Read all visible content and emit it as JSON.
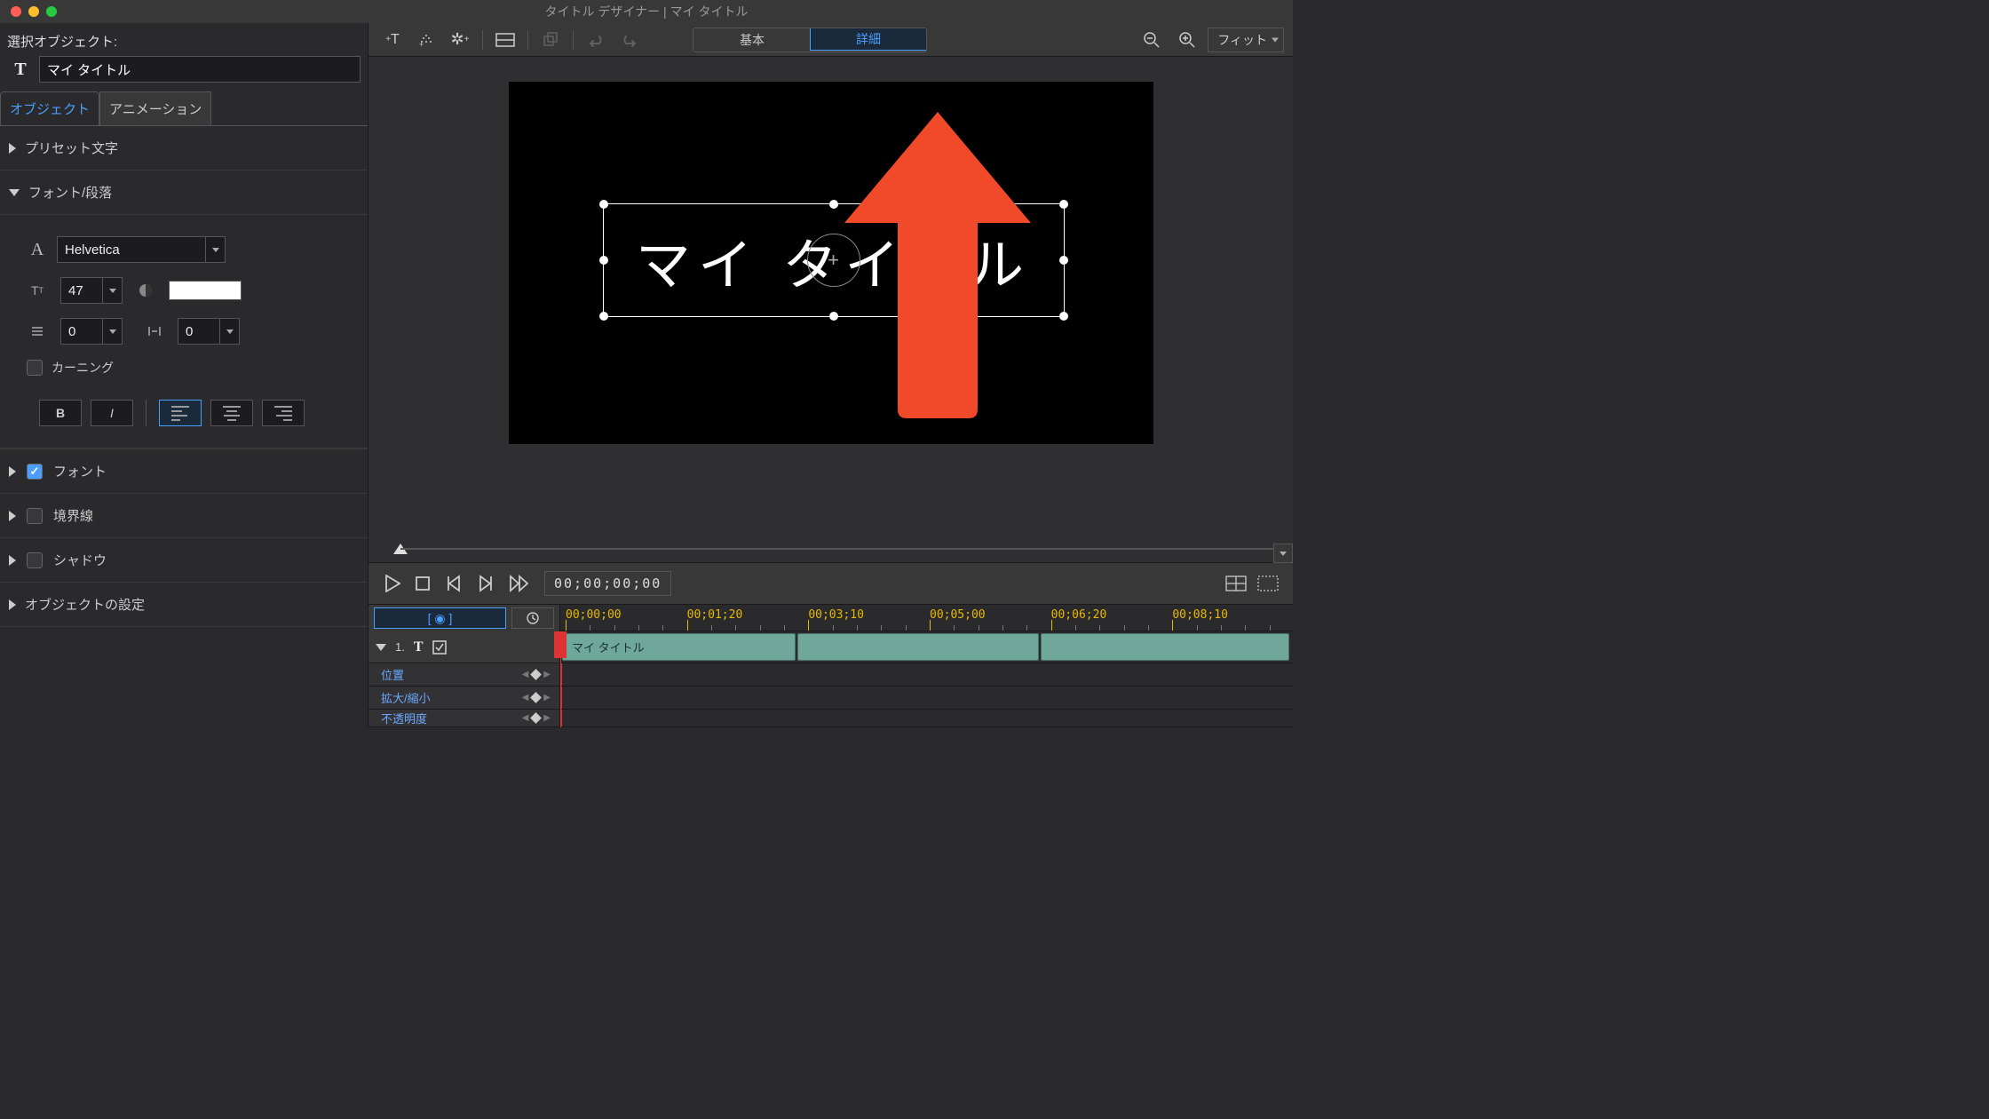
{
  "window": {
    "title": "タイトル デザイナー | マイ タイトル"
  },
  "sidebar": {
    "sel_label": "選択オブジェクト:",
    "sel_value": "マイ タイトル",
    "tabs": {
      "object": "オブジェクト",
      "animation": "アニメーション"
    },
    "sections": {
      "preset": "プリセット文字",
      "font_para": "フォント/段落",
      "font_check": "フォント",
      "border_check": "境界線",
      "shadow_check": "シャドウ",
      "object_settings": "オブジェクトの設定"
    },
    "font": {
      "family": "Helvetica",
      "size": "47",
      "line_spacing": "0",
      "tracking": "0",
      "kerning_label": "カーニング"
    }
  },
  "toolbar": {
    "mode_basic": "基本",
    "mode_advanced": "詳細",
    "zoom": "フィット"
  },
  "canvas": {
    "title_text": "マイ タイトル"
  },
  "playback": {
    "timecode": "00;00;00;00"
  },
  "timeline": {
    "ticks": [
      "00;00;00",
      "00;01;20",
      "00;03;10",
      "00;05;00",
      "00;06;20",
      "00;08;10"
    ],
    "track_index": "1.",
    "clip_label": "マイ タイトル",
    "props": {
      "position": "位置",
      "scale": "拡大/縮小",
      "opacity": "不透明度"
    }
  },
  "ruler_ctrl": {
    "eye": "[ ◉ ]"
  }
}
